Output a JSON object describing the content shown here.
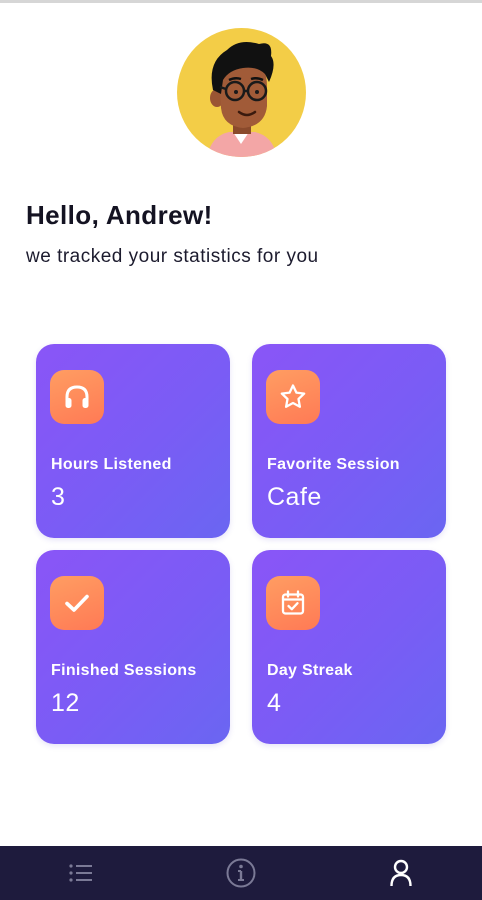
{
  "profile": {
    "greeting": "Hello, Andrew!",
    "subtitle": "we tracked your statistics for you"
  },
  "stats": [
    {
      "label": "Hours Listened",
      "value": "3",
      "icon": "headphones-icon"
    },
    {
      "label": "Favorite Session",
      "value": "Cafe",
      "icon": "star-icon"
    },
    {
      "label": "Finished Sessions",
      "value": "12",
      "icon": "checkmark-icon"
    },
    {
      "label": "Day Streak",
      "value": "4",
      "icon": "calendar-check-icon"
    }
  ],
  "nav": {
    "items": [
      {
        "icon": "list-icon",
        "active": false
      },
      {
        "icon": "info-icon",
        "active": false
      },
      {
        "icon": "profile-icon",
        "active": true
      }
    ]
  },
  "colors": {
    "card_gradient_start": "#8a55f7",
    "card_gradient_end": "#6a66f2",
    "icon_gradient_start": "#ff9d62",
    "icon_gradient_end": "#ff7a55",
    "bottom_bar": "#1e1b3d",
    "avatar_bg": "#f3cd47"
  }
}
